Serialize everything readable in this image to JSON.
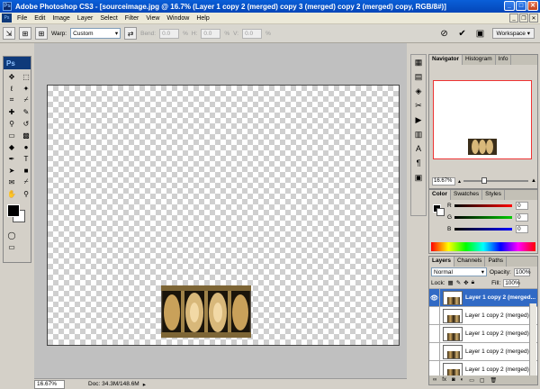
{
  "window": {
    "title": "Adobe Photoshop CS3 - [sourceimage.jpg @ 16.7% (Layer 1 copy 2 (merged) copy 3 (merged) copy 2 (merged) copy, RGB/8#)]",
    "app_icon": "Ps"
  },
  "menu": [
    "File",
    "Edit",
    "Image",
    "Layer",
    "Select",
    "Filter",
    "View",
    "Window",
    "Help"
  ],
  "options": {
    "warp_label": "Warp:",
    "warp_value": "Custom",
    "bend_label": "Bend:",
    "bend_value": "0.0",
    "h_label": "H:",
    "h_value": "0.0",
    "v_label": "V:",
    "v_value": "0.0",
    "pct": "%",
    "workspace_label": "Workspace ▾"
  },
  "toolbox": {
    "logo": "Ps"
  },
  "status": {
    "zoom": "16.67%",
    "doc": "Doc: 34.3M/148.6M"
  },
  "navigator": {
    "tabs": [
      "Navigator",
      "Histogram",
      "Info"
    ],
    "zoom": "16.67%"
  },
  "color": {
    "tabs": [
      "Color",
      "Swatches",
      "Styles"
    ],
    "r_label": "R",
    "r_value": "0",
    "g_label": "G",
    "g_value": "0",
    "b_label": "B",
    "b_value": "0"
  },
  "layers": {
    "tabs": [
      "Layers",
      "Channels",
      "Paths"
    ],
    "blend_mode": "Normal",
    "opacity_label": "Opacity:",
    "opacity_value": "100%",
    "lock_label": "Lock:",
    "fill_label": "Fill:",
    "fill_value": "100%",
    "rows": [
      "Layer 1 copy 2 (merged...",
      "Layer 1 copy 2 (merged)...",
      "Layer 1 copy 2 (merged)...",
      "Layer 1 copy 2 (merged)...",
      "Layer 1 copy 2 (merged)..."
    ]
  }
}
